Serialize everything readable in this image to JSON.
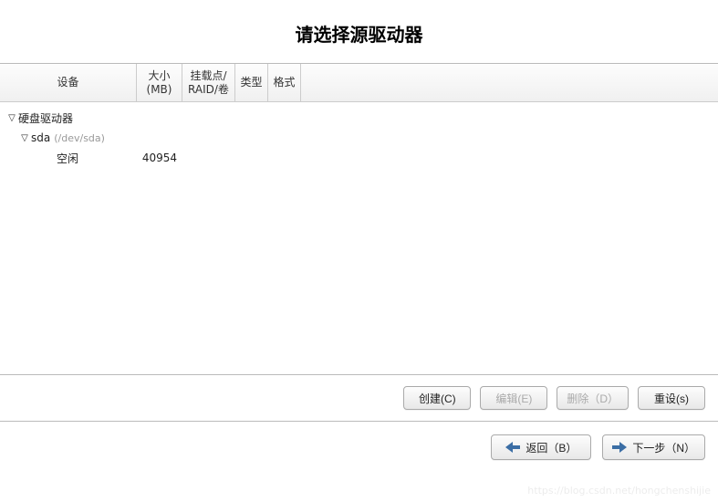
{
  "title": "请选择源驱动器",
  "columns": {
    "device": "设备",
    "size": "大小\n(MB)",
    "mount": "挂载点/\nRAID/卷",
    "type": "类型",
    "format": "格式"
  },
  "tree": {
    "root_label": "硬盘驱动器",
    "disk": {
      "name": "sda",
      "path": "(/dev/sda)"
    },
    "free": {
      "label": "空闲",
      "size": "40954"
    }
  },
  "actions": {
    "create": "创建(C)",
    "edit": "编辑(E)",
    "delete": "删除（D）",
    "reset": "重设(s)"
  },
  "nav": {
    "back": "返回（B）",
    "next": "下一步（N）"
  },
  "watermark": "https://blog.csdn.net/hongchenshijie"
}
